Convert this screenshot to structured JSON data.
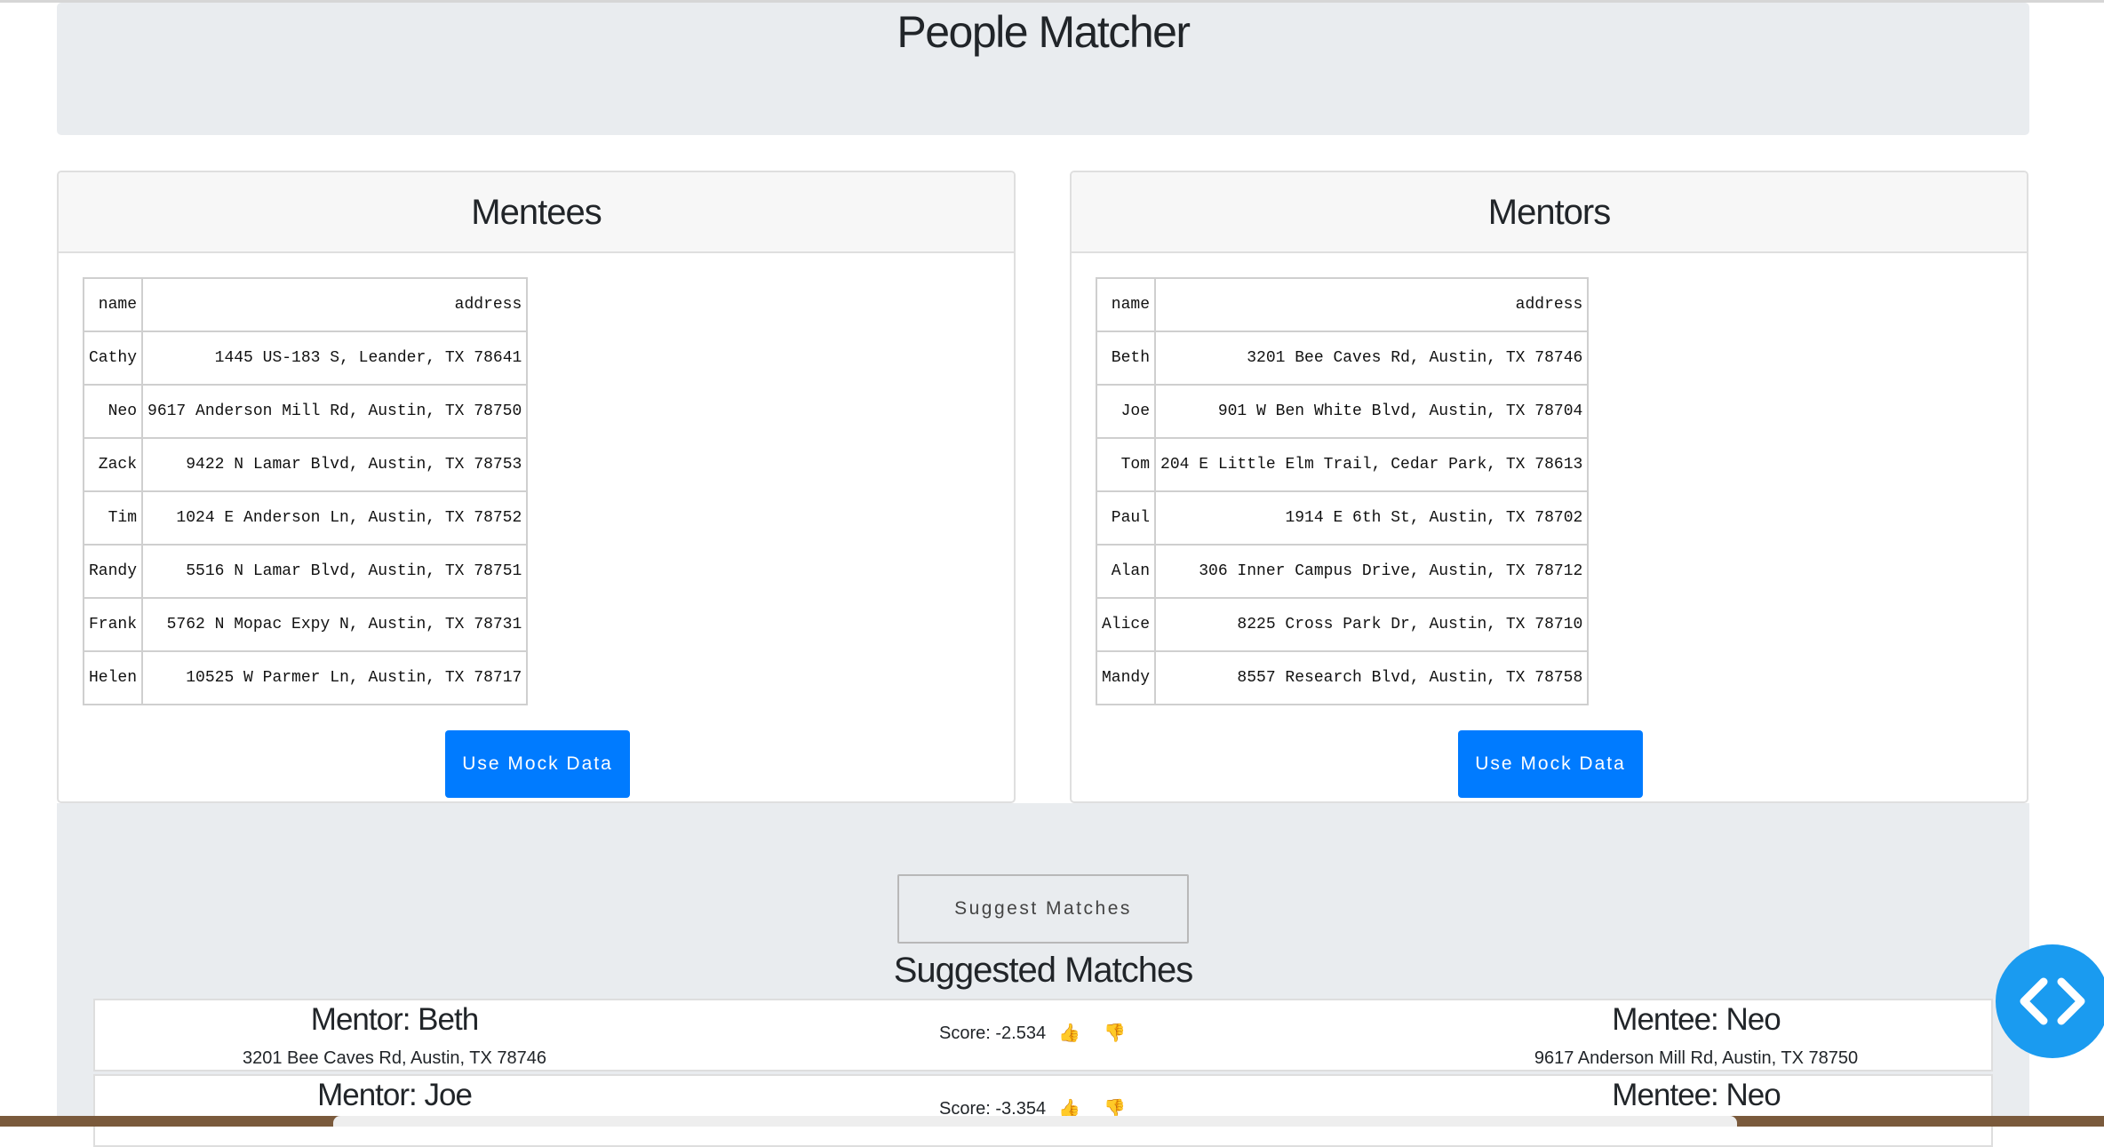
{
  "header": {
    "title": "People Matcher"
  },
  "mentees": {
    "title": "Mentees",
    "columns": [
      "name",
      "address"
    ],
    "rows": [
      [
        "Cathy",
        "1445 US-183 S, Leander, TX 78641"
      ],
      [
        "Neo",
        "9617 Anderson Mill Rd, Austin, TX 78750"
      ],
      [
        "Zack",
        "9422 N Lamar Blvd, Austin, TX 78753"
      ],
      [
        "Tim",
        "1024 E Anderson Ln, Austin, TX 78752"
      ],
      [
        "Randy",
        "5516 N Lamar Blvd, Austin, TX 78751"
      ],
      [
        "Frank",
        "5762 N Mopac Expy N, Austin, TX 78731"
      ],
      [
        "Helen",
        "10525 W Parmer Ln, Austin, TX 78717"
      ]
    ],
    "button_label": "Use Mock Data"
  },
  "mentors": {
    "title": "Mentors",
    "columns": [
      "name",
      "address"
    ],
    "rows": [
      [
        "Beth",
        "3201 Bee Caves Rd, Austin, TX 78746"
      ],
      [
        "Joe",
        "901 W Ben White Blvd, Austin, TX 78704"
      ],
      [
        "Tom",
        "204 E Little Elm Trail, Cedar Park, TX 78613"
      ],
      [
        "Paul",
        "1914 E 6th St, Austin, TX 78702"
      ],
      [
        "Alan",
        "306 Inner Campus Drive, Austin, TX 78712"
      ],
      [
        "Alice",
        "8225 Cross Park Dr, Austin, TX 78710"
      ],
      [
        "Mandy",
        "8557 Research Blvd, Austin, TX 78758"
      ]
    ],
    "button_label": "Use Mock Data"
  },
  "suggest": {
    "button_label": "Suggest Matches",
    "title": "Suggested Matches",
    "matches": [
      {
        "mentor": "Mentor: Beth",
        "mentor_address": "3201 Bee Caves Rd, Austin, TX 78746",
        "score": "Score: -2.534",
        "mentee": "Mentee: Neo",
        "mentee_address": "9617 Anderson Mill Rd, Austin, TX 78750"
      },
      {
        "mentor": "Mentor: Joe",
        "mentor_address": "",
        "score": "Score: -3.354",
        "mentee": "Mentee: Neo",
        "mentee_address": ""
      }
    ]
  },
  "icons": {
    "thumbs_up": "👍",
    "thumbs_down": "👎",
    "fab": "code-icon"
  },
  "colors": {
    "primary": "#007bff",
    "jumbotron": "#e9ecef",
    "fab": "#1a9bf0"
  }
}
